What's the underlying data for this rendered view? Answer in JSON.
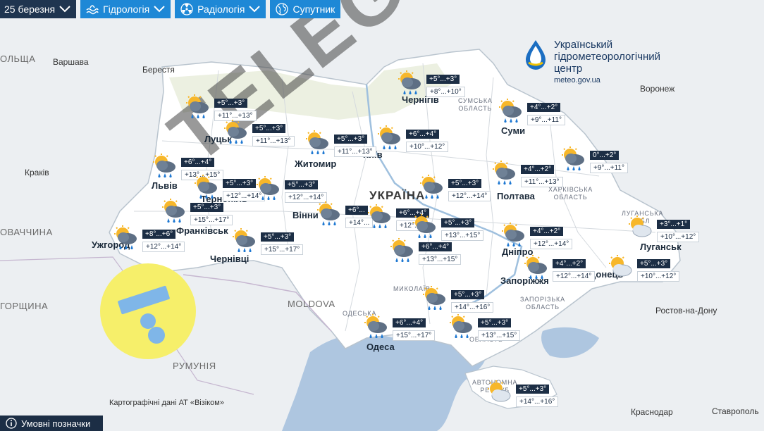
{
  "toolbar": {
    "date_label": "25 березня",
    "hydrology_label": "Гідрологія",
    "radiology_label": "Радіологія",
    "satellite_label": "Супутник"
  },
  "logo": {
    "line1": "Український",
    "line2": "гідрометеорологічний",
    "line3": "центр",
    "url": "meteo.gov.ua"
  },
  "map_labels": {
    "countries": {
      "poland": "ОЛЬЩА",
      "ukraine": "УКРАЇНА",
      "slovakia": "ОВАЧЧИНА",
      "hungary": "ГОРЩИНА",
      "moldova": "MOLDOVA",
      "romania": "РУМУНІЯ"
    },
    "cities": {
      "warsaw": "Варшава",
      "brest": "Берестя",
      "krakow": "Краків",
      "voronezh": "Воронеж",
      "rostov": "Ростов-на-Дону",
      "krasnodar": "Краснодар",
      "stavropol": "Ставрополь",
      "lutsk": "Луцьк",
      "lviv": "Львів",
      "ternopil": "Тернопіль",
      "ivano": "Франківськ",
      "uzhhorod": "Ужгород",
      "chernivtsi": "Чернівці",
      "zhytomyr": "Житомир",
      "kyiv": "Київ",
      "vinnytsia": "Вінни",
      "chernihiv": "Чернігів",
      "sumy": "Суми",
      "poltava": "Полтава",
      "dnipro": "Дніпро",
      "zaporizhzhia": "Запоріжжя",
      "luhansk": "Луганськ",
      "donetsk": "Донець",
      "odesa": "Одеса"
    },
    "oblasts": {
      "sumy": "СУМСЬКА\nОБЛАСТЬ",
      "kharkiv": "ХАРКІВСЬКА\nОБЛАСТЬ",
      "luhansk": "ЛУГАНСЬКА\nОБЛ",
      "zaporizhzhia": "ЗАПОРІЗЬКА\nОБЛАСТЬ",
      "mykolaiv": "МИКОЛАЇВ",
      "odesa": "ОДЕСЬКА",
      "kherson": "ОБЛАСТЬ",
      "crimea": "АВТОНОМНА\nРЕСПУБ"
    }
  },
  "forecasts": [
    {
      "region": "volyn",
      "day": "+5°...+3°",
      "night": "+11°...+13°",
      "icon": "rain-cloud-sun"
    },
    {
      "region": "rivne",
      "day": "+5°...+3°",
      "night": "+11°...+13°",
      "icon": "rain-cloud-sun"
    },
    {
      "region": "zhytomyr",
      "day": "+5°...+3°",
      "night": "+11°...+13°",
      "icon": "rain-cloud-sun"
    },
    {
      "region": "kyiv",
      "day": "+6°...+4°",
      "night": "+10°...+12°",
      "icon": "rain-cloud-sun"
    },
    {
      "region": "chernihiv",
      "day": "+5°...+3°",
      "night": "+8°...+10°",
      "icon": "rain-cloud-sun"
    },
    {
      "region": "sumy",
      "day": "+4°...+2°",
      "night": "+9°...+11°",
      "icon": "rain-cloud-sun"
    },
    {
      "region": "kharkiv",
      "day": "0°...+2°",
      "night": "+9°...+11°",
      "icon": "rain-cloud-sun"
    },
    {
      "region": "lviv",
      "day": "+6°...+4°",
      "night": "+13°...+15°",
      "icon": "rain-cloud-sun"
    },
    {
      "region": "ternopil",
      "day": "+5°...+3°",
      "night": "+12°...+14°",
      "icon": "rain-cloud-sun"
    },
    {
      "region": "khmelnytskyi",
      "day": "+5°...+3°",
      "night": "+12°...+14°",
      "icon": "rain-cloud-sun"
    },
    {
      "region": "vinnytsia",
      "day": "+6°...",
      "night": "+14°...",
      "icon": "rain-cloud-sun"
    },
    {
      "region": "cherkasy",
      "day": "+6°...+4°",
      "night": "+12°...",
      "icon": "rain-cloud-sun"
    },
    {
      "region": "poltava-w",
      "day": "+5°...+3°",
      "night": "+12°...+14°",
      "icon": "rain-cloud-sun"
    },
    {
      "region": "poltava",
      "day": "+4°...+2°",
      "night": "+11°...+13°",
      "icon": "rain-cloud-sun"
    },
    {
      "region": "ivano",
      "day": "+5°...+3°",
      "night": "+15°...+17°",
      "icon": "rain-cloud-sun"
    },
    {
      "region": "zakarpattia",
      "day": "+8°...+6°",
      "night": "+12°...+14°",
      "icon": "rain-cloud-sun"
    },
    {
      "region": "chernivtsi",
      "day": "+5°...+3°",
      "night": "+15°...+17°",
      "icon": "rain-cloud-sun"
    },
    {
      "region": "kirovohrad",
      "day": "+5°...+3°",
      "night": "+13°...+15°",
      "icon": "rain-cloud-sun"
    },
    {
      "region": "kirovohrad-s",
      "day": "+6°...+4°",
      "night": "+13°...+15°",
      "icon": "rain-cloud-sun"
    },
    {
      "region": "dnipro",
      "day": "+4°...+2°",
      "night": "+12°...+14°",
      "icon": "rain-cloud-sun"
    },
    {
      "region": "luhansk",
      "day": "+3°...+1°",
      "night": "+10°...+12°",
      "icon": "cloud-sun"
    },
    {
      "region": "zaporizhzhia",
      "day": "+4°...+2°",
      "night": "+12°...+14°",
      "icon": "rain-cloud-sun"
    },
    {
      "region": "donetsk",
      "day": "+5°...+3°",
      "night": "+10°...+12°",
      "icon": "cloud-sun"
    },
    {
      "region": "mykolaiv",
      "day": "+5°...+3°",
      "night": "+14°...+16°",
      "icon": "rain-cloud-sun"
    },
    {
      "region": "odesa",
      "day": "+6°...+4°",
      "night": "+15°...+17°",
      "icon": "rain-cloud-sun"
    },
    {
      "region": "kherson",
      "day": "+5°...+3°",
      "night": "+13°...+15°",
      "icon": "rain-cloud-sun"
    },
    {
      "region": "crimea",
      "day": "+5°...+3°",
      "night": "+14°...+16°",
      "icon": "cloud-sun"
    }
  ],
  "watermark": "TELEGRAF",
  "credit": "Картографічні дані АТ «Візіком»",
  "legend_label": "Умовні позначки",
  "colors": {
    "nav_dark": "#1f3550",
    "nav_blue": "#1e88d6",
    "ukraine_fill": "#ffffff",
    "sea": "#aac4e0"
  }
}
